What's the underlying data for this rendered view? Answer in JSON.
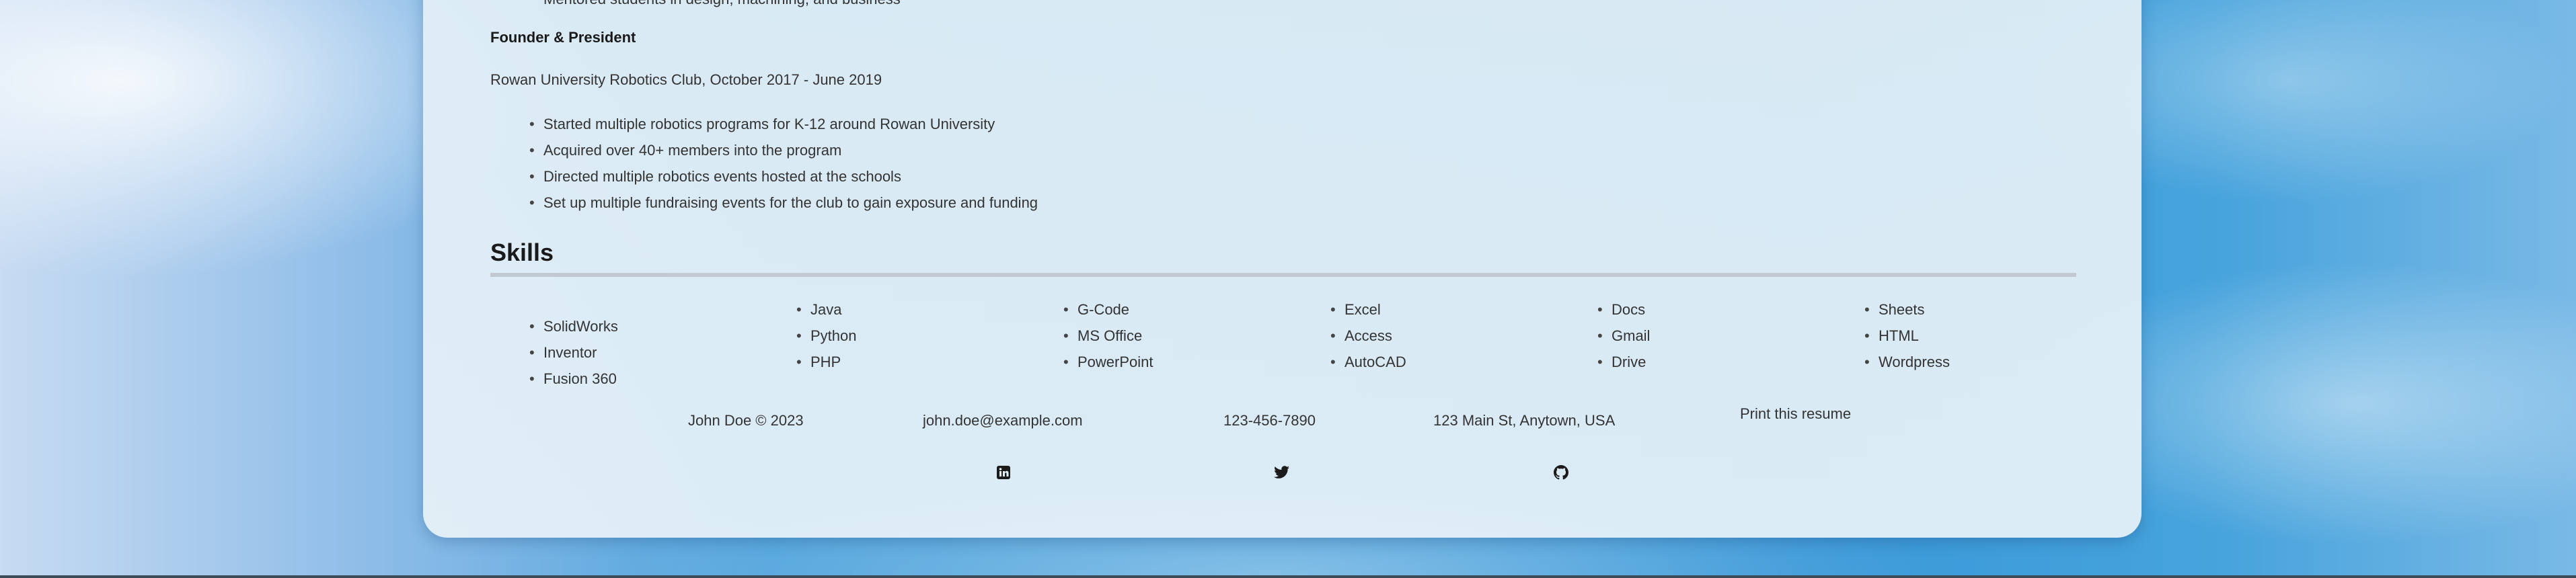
{
  "previous_item_fragment": "Mentored students in design, machining, and business",
  "experience": {
    "title": "Founder & President",
    "org_dates": "Rowan University Robotics Club, October 2017 - June 2019",
    "duties": [
      "Started multiple robotics programs for K-12 around Rowan University",
      "Acquired over 40+ members into the program",
      "Directed multiple robotics events hosted at the schools",
      "Set up multiple fundraising events for the club to gain exposure and funding"
    ]
  },
  "skills": {
    "heading": "Skills",
    "columns": [
      [
        "SolidWorks",
        "Inventor",
        "Fusion 360"
      ],
      [
        "Java",
        "Python",
        "PHP"
      ],
      [
        "G-Code",
        "MS Office",
        "PowerPoint"
      ],
      [
        "Excel",
        "Access",
        "AutoCAD"
      ],
      [
        "Docs",
        "Gmail",
        "Drive"
      ],
      [
        "Sheets",
        "HTML",
        "Wordpress"
      ]
    ]
  },
  "footer": {
    "copyright": "John Doe © 2023",
    "email": "john.doe@example.com",
    "phone": "123-456-7890",
    "address": "123 Main St, Anytown, USA",
    "print_label": "Print this resume",
    "social_icons": [
      "linkedin-icon",
      "twitter-icon",
      "github-icon"
    ]
  },
  "colors": {
    "card_background": "#e3eef6",
    "text": "#333333",
    "heading_rule": "#c3cacf",
    "sky": "#3a98d8"
  }
}
